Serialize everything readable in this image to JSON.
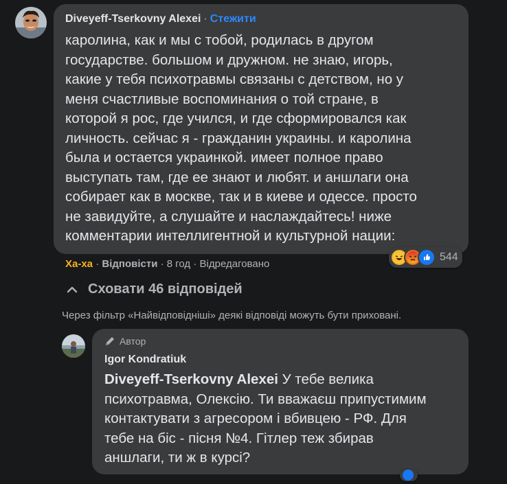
{
  "comment": {
    "author": "Diveyeff-Tserkovny Alexei",
    "separator": "·",
    "follow_label": "Стежити",
    "text": "каролина, как и мы с тобой, родилась в другом\nгосударстве. большом и дружном. не знаю, игорь,\nкакие у тебя психотравмы связаны с детством, но у\nменя счастливые воспоминания о той стране, в\nкоторой я рос, где учился, и где сформировался как\nличность. сейчас я - гражданин украины. и каролина\nбыла и остается украинкой. имеет полное право\nвыступать там, где ее знают и любят. и аншлаги она\nсобирает как в москве, так и в киеве и одессе. просто\nне завидуйте, а слушайте и наслаждайтесь! ниже\nкомментарии интеллигентной и культурной нации:",
    "reaction_label": "Ха-ха",
    "reply_label": "Відповісти",
    "time": "8 год",
    "edited_label": "Відредаговано",
    "reaction_count": "544",
    "reaction_icons": [
      "haha-emoji-icon",
      "angry-emoji-icon",
      "like-emoji-icon"
    ]
  },
  "replies_toggle": {
    "label": "Сховати 46 відповідей",
    "icon": "chevron-up-icon"
  },
  "filter_note": "Через фільтр «Найвідповідніші» деякі відповіді можуть бути приховані.",
  "reply": {
    "badge_label": "Автор",
    "badge_icon": "pencil-icon",
    "author": "Igor Kondratiuk",
    "mention": "Diveyeff-Tserkovny Alexei",
    "text": " У тебе велика\nпсихотравма, Олексію. Ти вважаєш припустимим\nконтактувати з агресором і вбивцею - РФ. Для\nтебе на біс - пісня №4. Гітлер теж збирав\nаншлаги, ти ж в курсі?"
  },
  "colors": {
    "background": "#18191a",
    "bubble": "#3a3b3c",
    "text": "#e4e6eb",
    "muted": "#b0b3b8",
    "link": "#2d88ff",
    "haha": "#f7b125"
  }
}
